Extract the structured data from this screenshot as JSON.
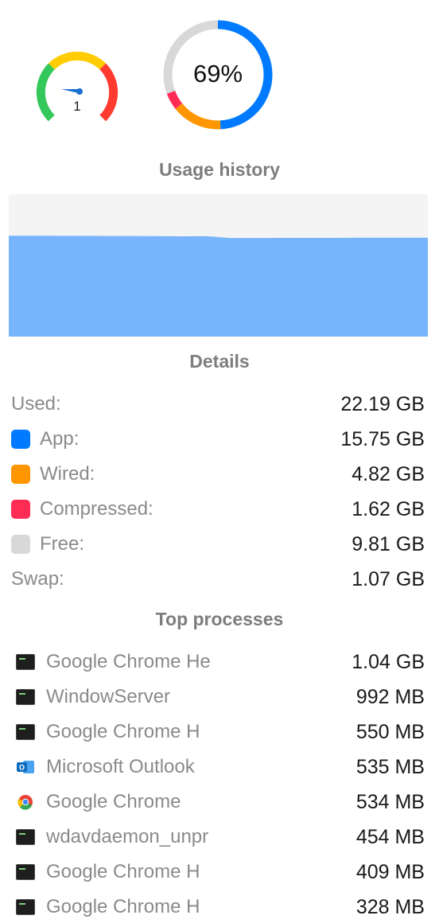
{
  "gauge": {
    "value_label": "1",
    "colors": [
      "#34c759",
      "#ffcc00",
      "#ff3b30"
    ],
    "needle_color": "#1a6fd1"
  },
  "donut": {
    "percent_label": "69%",
    "segments": [
      {
        "name": "App",
        "fraction": 0.4922,
        "color": "#007aff"
      },
      {
        "name": "Wired",
        "fraction": 0.1506,
        "color": "#ff9500"
      },
      {
        "name": "Compressed",
        "fraction": 0.0506,
        "color": "#ff2d55"
      },
      {
        "name": "Free",
        "fraction": 0.3066,
        "color": "#d8d8d8"
      }
    ]
  },
  "history": {
    "title": "Usage history",
    "fill_color": "#78b4fb",
    "background_color": "#f4f4f4",
    "usage_fractions": [
      0.708,
      0.708,
      0.707,
      0.707,
      0.706,
      0.706,
      0.705,
      0.704,
      0.705,
      0.692,
      0.692,
      0.693,
      0.693,
      0.693,
      0.694,
      0.694,
      0.694,
      0.694
    ]
  },
  "details": {
    "title": "Details",
    "rows": [
      {
        "label": "Used:",
        "value": "22.19 GB",
        "color": ""
      },
      {
        "label": "App:",
        "value": "15.75 GB",
        "color": "#007aff"
      },
      {
        "label": "Wired:",
        "value": "4.82 GB",
        "color": "#ff9500"
      },
      {
        "label": "Compressed:",
        "value": "1.62 GB",
        "color": "#ff2d55"
      },
      {
        "label": "Free:",
        "value": "9.81 GB",
        "color": "#d8d8d8"
      },
      {
        "label": "Swap:",
        "value": "1.07 GB",
        "color": ""
      }
    ]
  },
  "processes": {
    "title": "Top processes",
    "items": [
      {
        "name": "Google Chrome He",
        "value": "1.04 GB",
        "icon": "terminal-icon"
      },
      {
        "name": "WindowServer",
        "value": "992 MB",
        "icon": "terminal-icon"
      },
      {
        "name": "Google Chrome H",
        "value": "550 MB",
        "icon": "terminal-icon"
      },
      {
        "name": "Microsoft Outlook",
        "value": "535 MB",
        "icon": "outlook-icon"
      },
      {
        "name": "Google Chrome",
        "value": "534 MB",
        "icon": "chrome-icon"
      },
      {
        "name": "wdavdaemon_unpr",
        "value": "454 MB",
        "icon": "terminal-icon"
      },
      {
        "name": "Google Chrome H",
        "value": "409 MB",
        "icon": "terminal-icon"
      },
      {
        "name": "Google Chrome H",
        "value": "328 MB",
        "icon": "terminal-icon"
      }
    ]
  }
}
